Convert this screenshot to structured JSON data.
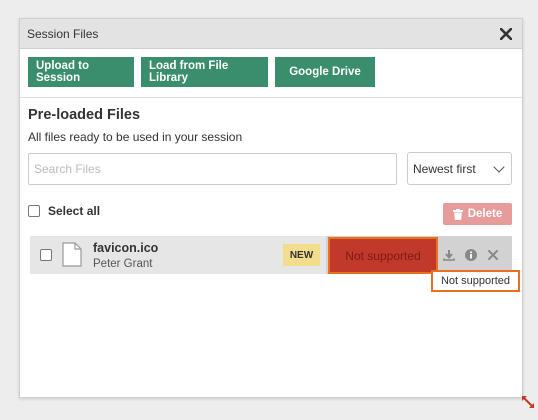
{
  "dialog": {
    "title": "Session Files",
    "close_icon": "close-icon"
  },
  "toolbar": {
    "upload_label": "Upload to Session",
    "library_label": "Load from File Library",
    "drive_label": "Google Drive"
  },
  "content": {
    "heading": "Pre-loaded Files",
    "subtext": "All files ready to be used in your session",
    "search_placeholder": "Search Files",
    "sort_value": "Newest first",
    "select_all_label": "Select all",
    "delete_label": "Delete"
  },
  "files": [
    {
      "name": "favicon.ico",
      "owner": "Peter Grant",
      "badge": "NEW",
      "status": "Not supported",
      "actions": [
        "download-icon",
        "info-icon",
        "close-icon"
      ]
    }
  ],
  "tooltip": {
    "text": "Not supported"
  },
  "colors": {
    "primary_green": "#3a8e6e",
    "delete_pink": "#e79c9c",
    "status_red": "#c0392b",
    "highlight_orange": "#e8701e",
    "badge_yellow": "#f1dd8c"
  }
}
